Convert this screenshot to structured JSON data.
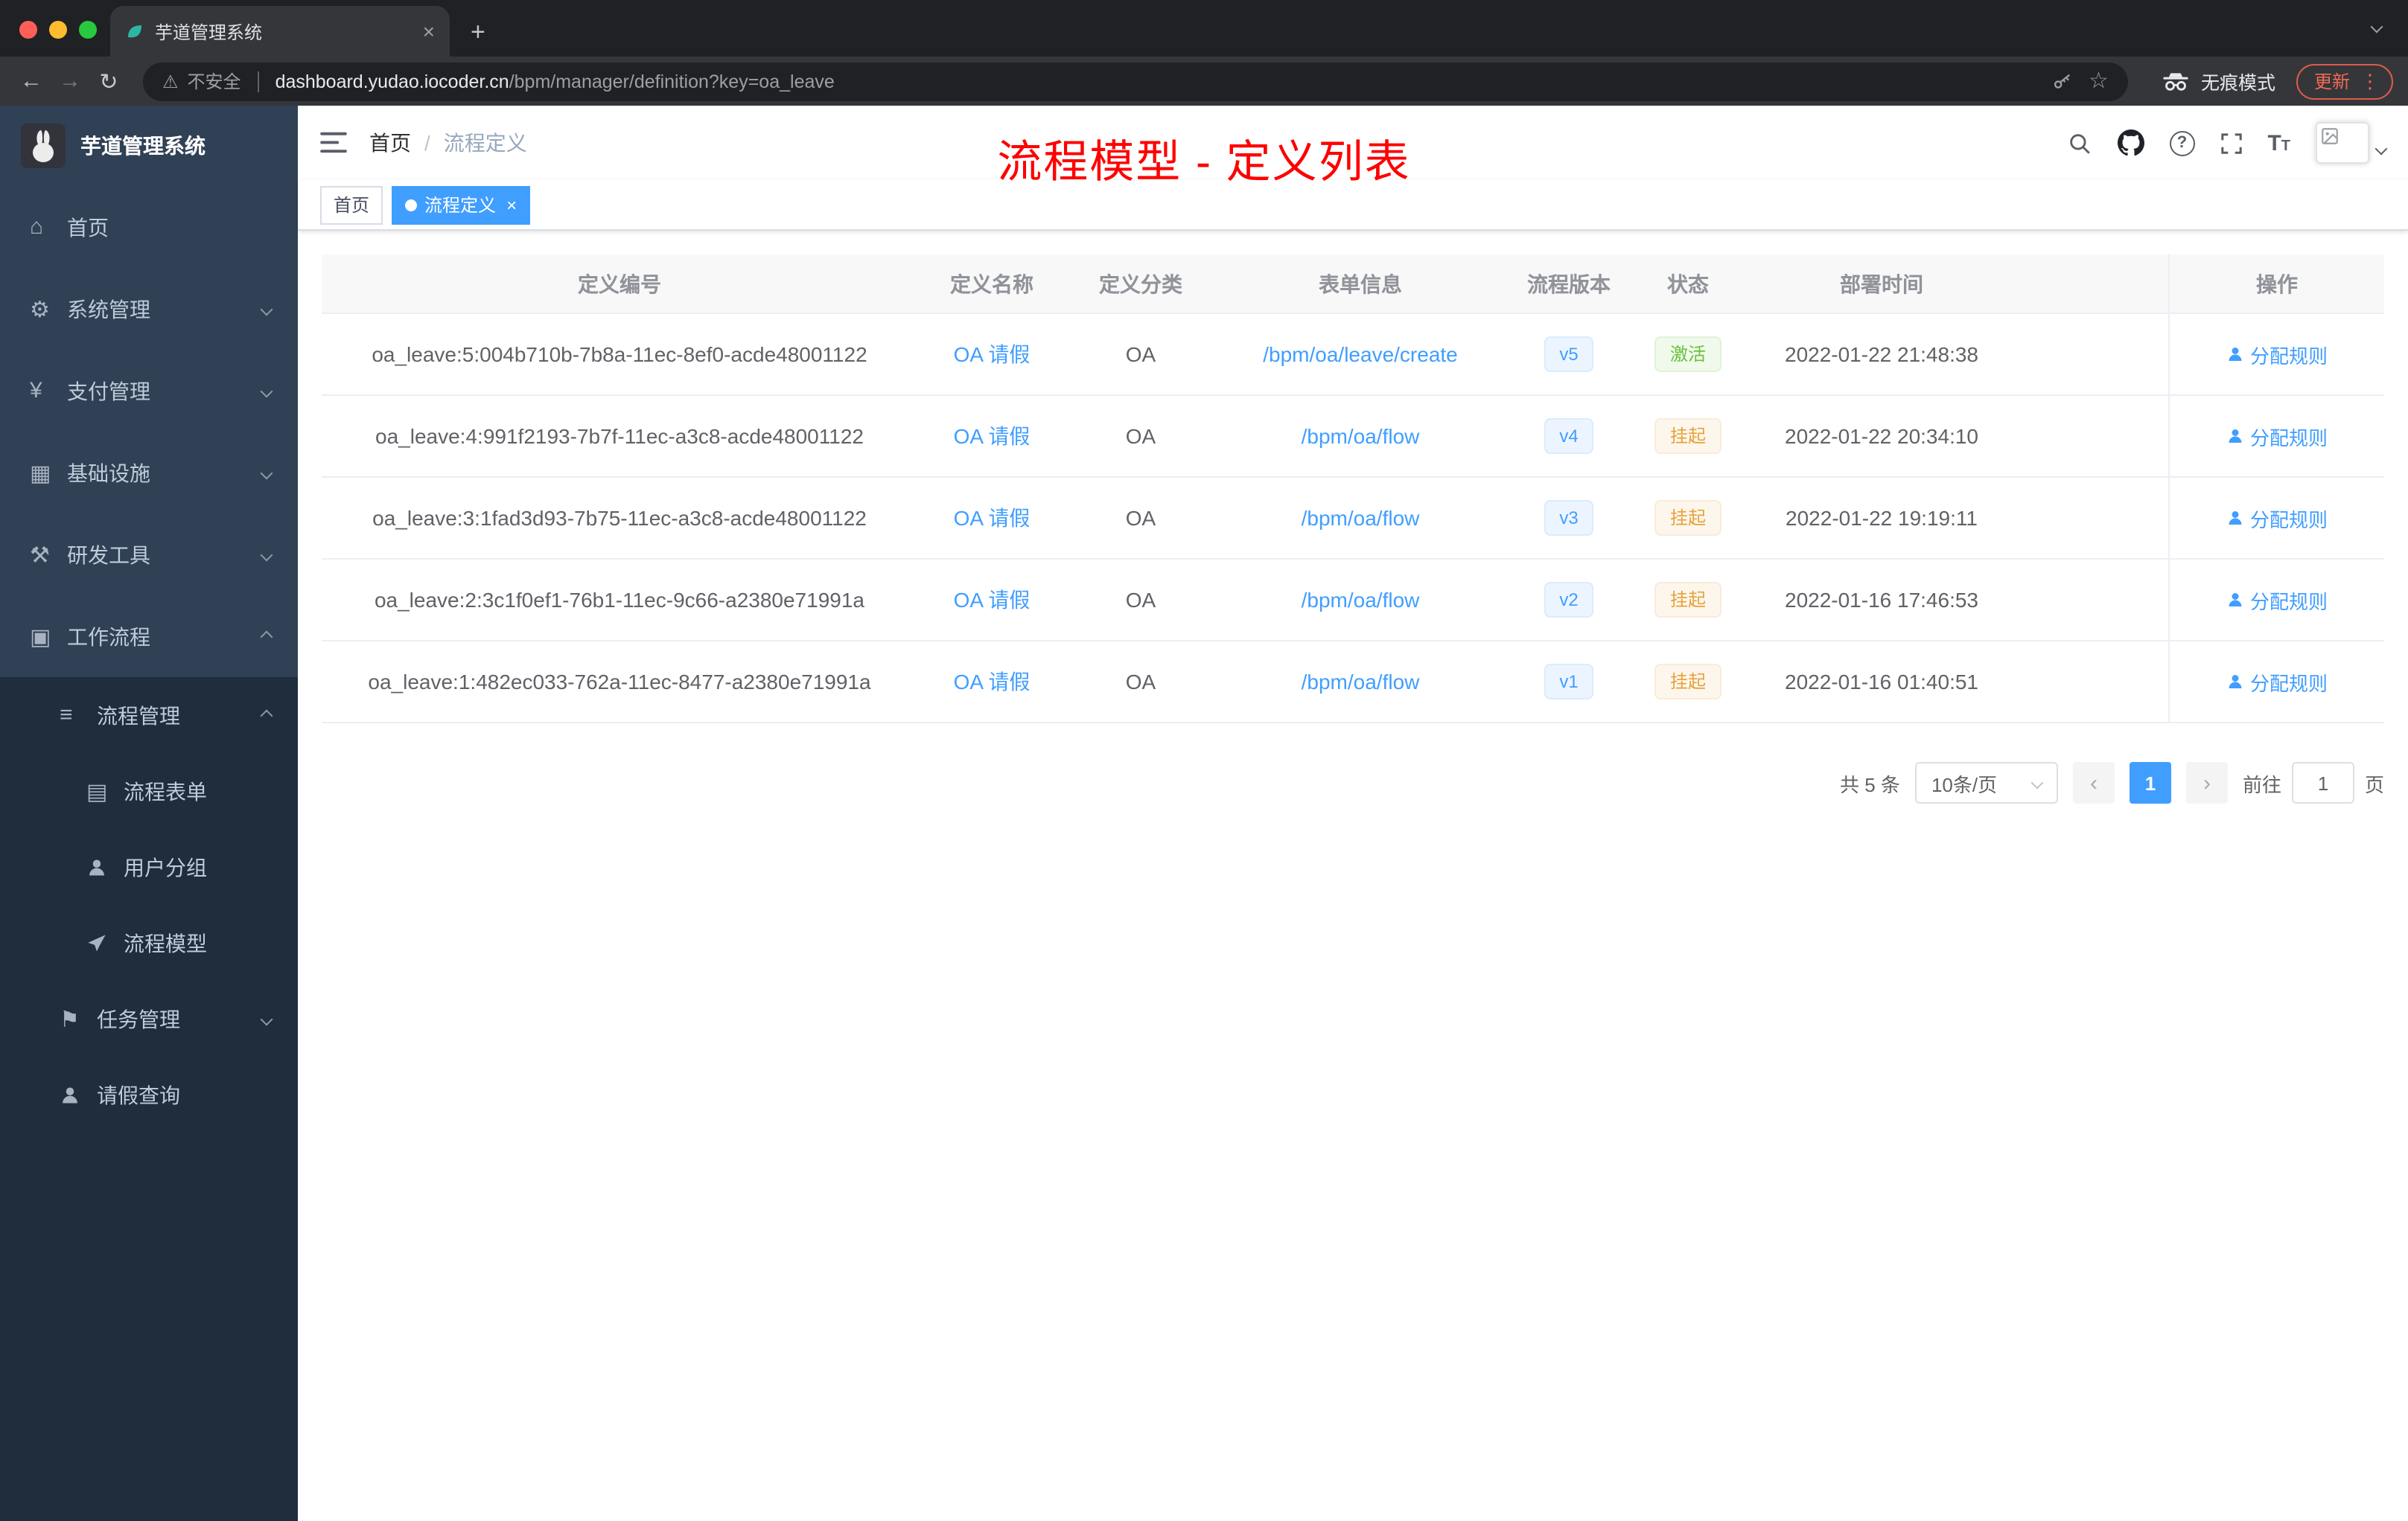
{
  "colors": {
    "accent_blue": "#409eff",
    "success_green": "#67c23a",
    "warning_orange": "#e6a23c",
    "annotation_red": "#fe0000",
    "sidebar_bg": "#304156",
    "submenu_bg": "#1f2d3d",
    "active_tag_bg": "#409eff"
  },
  "browser": {
    "tab_title": "芋道管理系统",
    "security_label": "不安全",
    "url_domain": "dashboard.yudao.iocoder.cn",
    "url_path": "/bpm/manager/definition?key=oa_leave",
    "incognito_label": "无痕模式",
    "update_label": "更新"
  },
  "annotation": "流程模型 - 定义列表",
  "sidebar": {
    "logo_title": "芋道管理系统",
    "items": [
      {
        "label": "首页"
      },
      {
        "label": "系统管理"
      },
      {
        "label": "支付管理"
      },
      {
        "label": "基础设施"
      },
      {
        "label": "研发工具"
      },
      {
        "label": "工作流程"
      }
    ],
    "submenu": [
      {
        "label": "流程管理"
      },
      {
        "label": "流程表单"
      },
      {
        "label": "用户分组"
      },
      {
        "label": "流程模型"
      },
      {
        "label": "任务管理"
      },
      {
        "label": "请假查询"
      }
    ]
  },
  "navbar": {
    "breadcrumb_home": "首页",
    "breadcrumb_separator": "/",
    "breadcrumb_current": "流程定义"
  },
  "tags": [
    {
      "label": "首页"
    },
    {
      "label": "流程定义"
    }
  ],
  "table": {
    "headers": [
      "定义编号",
      "定义名称",
      "定义分类",
      "表单信息",
      "流程版本",
      "状态",
      "部署时间",
      "操作"
    ],
    "rows": [
      {
        "id": "oa_leave:5:004b710b-7b8a-11ec-8ef0-acde48001122",
        "name": "OA 请假",
        "category": "OA",
        "form": "/bpm/oa/leave/create",
        "version": "v5",
        "status": "激活",
        "status_type": "success",
        "deploy_time": "2022-01-22 21:48:38",
        "action": "分配规则"
      },
      {
        "id": "oa_leave:4:991f2193-7b7f-11ec-a3c8-acde48001122",
        "name": "OA 请假",
        "category": "OA",
        "form": "/bpm/oa/flow",
        "version": "v4",
        "status": "挂起",
        "status_type": "warning",
        "deploy_time": "2022-01-22 20:34:10",
        "action": "分配规则"
      },
      {
        "id": "oa_leave:3:1fad3d93-7b75-11ec-a3c8-acde48001122",
        "name": "OA 请假",
        "category": "OA",
        "form": "/bpm/oa/flow",
        "version": "v3",
        "status": "挂起",
        "status_type": "warning",
        "deploy_time": "2022-01-22 19:19:11",
        "action": "分配规则"
      },
      {
        "id": "oa_leave:2:3c1f0ef1-76b1-11ec-9c66-a2380e71991a",
        "name": "OA 请假",
        "category": "OA",
        "form": "/bpm/oa/flow",
        "version": "v2",
        "status": "挂起",
        "status_type": "warning",
        "deploy_time": "2022-01-16 17:46:53",
        "action": "分配规则"
      },
      {
        "id": "oa_leave:1:482ec033-762a-11ec-8477-a2380e71991a",
        "name": "OA 请假",
        "category": "OA",
        "form": "/bpm/oa/flow",
        "version": "v1",
        "status": "挂起",
        "status_type": "warning",
        "deploy_time": "2022-01-16 01:40:51",
        "action": "分配规则"
      }
    ]
  },
  "pagination": {
    "total": "共 5 条",
    "page_size": "10条/页",
    "current_page": "1",
    "goto_label": "前往",
    "goto_value": "1",
    "page_unit": "页"
  }
}
